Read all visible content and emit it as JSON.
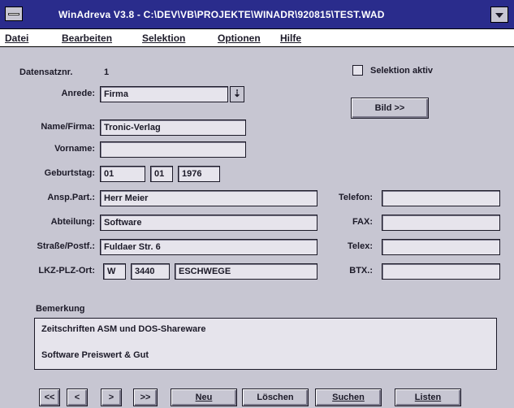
{
  "window": {
    "title": "WinAdreva V3.8 - C:\\DEV\\VB\\PROJEKTE\\WINADR\\920815\\TEST.WAD"
  },
  "menubar": {
    "items": [
      "Datei",
      "Bearbeiten",
      "Selektion",
      "Optionen",
      "Hilfe"
    ]
  },
  "record": {
    "label": "Datensatznr.",
    "value": "1"
  },
  "selection_checkbox": {
    "label": "Selektion aktiv",
    "checked": false
  },
  "bild_button": "Bild >>",
  "form": {
    "anrede_label": "Anrede:",
    "anrede_value": "Firma",
    "name_label": "Name/Firma:",
    "name_value": "Tronic-Verlag",
    "vorname_label": "Vorname:",
    "vorname_value": "",
    "geburtstag_label": "Geburtstag:",
    "geburtstag_day": "01",
    "geburtstag_month": "01",
    "geburtstag_year": "1976",
    "ansp_label": "Ansp.Part.:",
    "ansp_value": "Herr Meier",
    "abteilung_label": "Abteilung:",
    "abteilung_value": "Software",
    "strasse_label": "Straße/Postf.:",
    "strasse_value": "Fuldaer Str. 6",
    "lkz_label": "LKZ-PLZ-Ort:",
    "lkz_value": "W",
    "plz_value": "3440",
    "ort_value": "ESCHWEGE",
    "telefon_label": "Telefon:",
    "telefon_value": "",
    "fax_label": "FAX:",
    "fax_value": "",
    "telex_label": "Telex:",
    "telex_value": "",
    "btx_label": "BTX.:",
    "btx_value": ""
  },
  "bemerkung": {
    "label": "Bemerkung",
    "line1": "Zeitschriften ASM und DOS-Shareware",
    "line2": "Software Preiswert & Gut"
  },
  "nav": {
    "first": "<<",
    "prev": "<",
    "next": ">",
    "last": ">>",
    "neu": "Neu",
    "loeschen": "Löschen",
    "suchen": "Suchen",
    "listen": "Listen"
  },
  "colors": {
    "titlebar": "#2a2c8c",
    "window_bg": "#c7c6d2",
    "field_bg": "#e6e4ec"
  }
}
